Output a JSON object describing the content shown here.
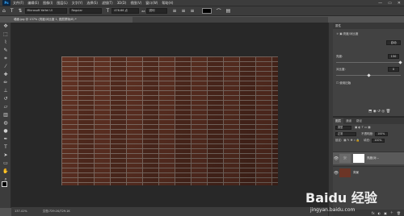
{
  "app": {
    "logo_text": "Ps"
  },
  "menubar": {
    "items": [
      "文件(F)",
      "编辑(E)",
      "图像(I)",
      "图层(L)",
      "文字(Y)",
      "选择(S)",
      "滤镜(T)",
      "3D(D)",
      "视图(V)",
      "窗口(W)",
      "帮助(H)"
    ],
    "window_controls": [
      "—",
      "▭",
      "✕"
    ]
  },
  "options": {
    "font_family": "Microsoft YaHei UI",
    "font_style": "Regular",
    "font_size": "476.66 点",
    "aa_label": "aa",
    "aa_value": "锐利"
  },
  "document": {
    "tab_title": "墙面.jpg @ 137% (亮度/对比度 1, 图层蒙版/8) *"
  },
  "status": {
    "zoom": "137.41%",
    "doc_info": "文档:729.1K/729.1K"
  },
  "properties": {
    "tab_label": "属性",
    "adjustment_name": "亮度/对比度",
    "auto_label": "自动",
    "brightness_label": "亮度:",
    "brightness_value": "150",
    "brightness_level": 1.0,
    "contrast_label": "对比度:",
    "contrast_value": "0",
    "contrast_level": 0.5,
    "legacy_label": "使用旧版"
  },
  "layers": {
    "tabs": [
      "图层",
      "通道",
      "路径"
    ],
    "kind_label": "类型",
    "blend_mode": "正常",
    "opacity_label": "不透明度:",
    "opacity_value": "100%",
    "lock_label": "锁定:",
    "fill_label": "填充:",
    "fill_value": "100%",
    "items": [
      {
        "name": "亮度/对..."
      },
      {
        "name": "背景"
      }
    ],
    "bottom_icons": [
      "fx",
      "◐",
      "▣",
      "＋",
      "🗑"
    ]
  },
  "watermark": {
    "brand": "Baidu 经验",
    "url": "jingyan.baidu.com"
  },
  "colors": {
    "accent": "#31a8ff",
    "panel_bg": "#424242",
    "brick": "#5b2f22"
  }
}
